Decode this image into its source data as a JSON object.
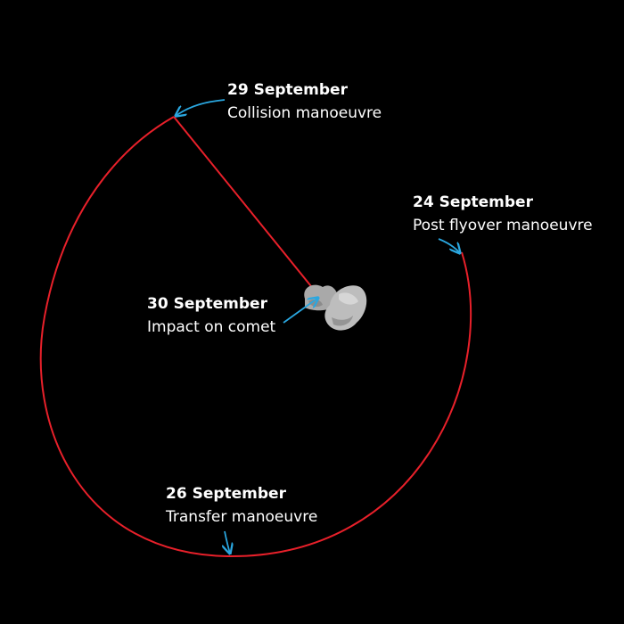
{
  "colors": {
    "background": "#000000",
    "trajectory": "#e8202a",
    "pointer": "#2aa7e0",
    "text": "#ffffff",
    "comet": "#b5b5b5"
  },
  "events": {
    "sep29": {
      "date": "29 September",
      "description": "Collision manoeuvre"
    },
    "sep24": {
      "date": "24 September",
      "description": "Post flyover manoeuvre"
    },
    "sep30": {
      "date": "30 September",
      "description": "Impact on comet"
    },
    "sep26": {
      "date": "26 September",
      "description": "Transfer manoeuvre"
    }
  }
}
